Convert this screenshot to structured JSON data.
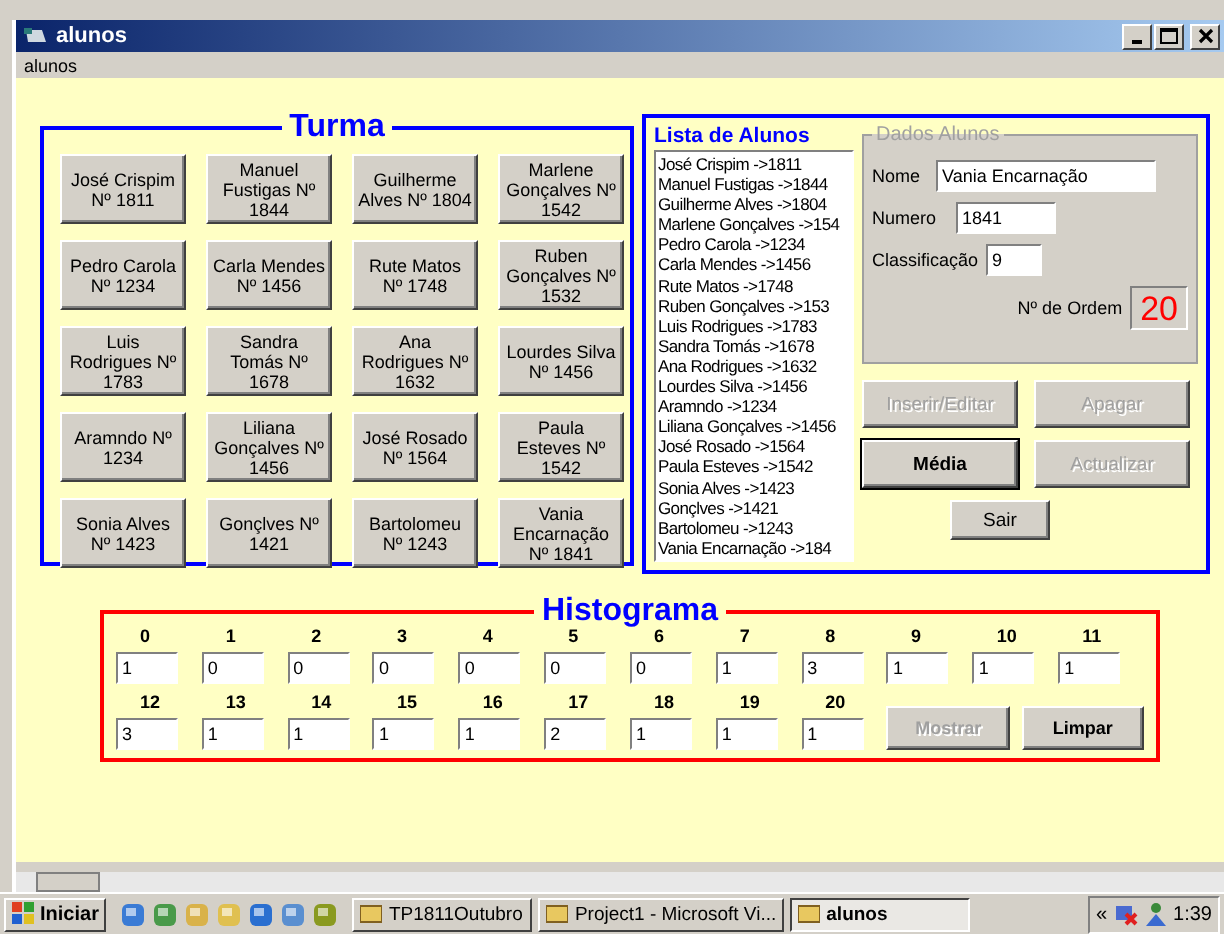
{
  "window": {
    "title": "alunos",
    "menu": [
      "alunos"
    ]
  },
  "turma": {
    "title": "Turma",
    "students": [
      "José Crispim Nº 1811",
      "Manuel Fustigas Nº 1844",
      "Guilherme Alves Nº 1804",
      "Marlene Gonçalves Nº 1542",
      "Pedro Carola Nº 1234",
      "Carla Mendes Nº 1456",
      "Rute Matos Nº 1748",
      "Ruben Gonçalves Nº 1532",
      "Luis Rodrigues Nº 1783",
      "Sandra Tomás Nº 1678",
      "Ana Rodrigues Nº 1632",
      "Lourdes Silva Nº 1456",
      "Aramndo Nº 1234",
      "Liliana Gonçalves Nº 1456",
      "José Rosado Nº 1564",
      "Paula Esteves Nº 1542",
      "Sonia Alves Nº 1423",
      "Gonçlves Nº 1421",
      "Bartolomeu Nº 1243",
      "Vania Encarnação Nº 1841"
    ]
  },
  "lista": {
    "title": "Lista de Alunos",
    "items": [
      "José Crispim ->1811",
      "Manuel Fustigas ->1844",
      "Guilherme Alves ->1804",
      "Marlene Gonçalves ->154",
      "Pedro Carola ->1234",
      "Carla Mendes ->1456",
      "Rute Matos ->1748",
      "Ruben Gonçalves ->153",
      "Luis Rodrigues ->1783",
      "Sandra Tomás ->1678",
      "Ana Rodrigues ->1632",
      "Lourdes Silva ->1456",
      "Aramndo ->1234",
      "Liliana Gonçalves ->1456",
      "José Rosado ->1564",
      "Paula Esteves ->1542",
      "Sonia Alves ->1423",
      "Gonçlves ->1421",
      "Bartolomeu ->1243",
      "Vania Encarnação ->184"
    ]
  },
  "dados": {
    "title": "Dados Alunos",
    "nome_label": "Nome",
    "nome": "Vania Encarnação",
    "numero_label": "Numero",
    "numero": "1841",
    "classificacao_label": "Classificação",
    "classificacao": "9",
    "ordem_label": "Nº de Ordem",
    "ordem": "20"
  },
  "buttons": [
    {
      "label": "Inserir/Editar",
      "disabled": true,
      "default": false
    },
    {
      "label": "Apagar",
      "disabled": true,
      "default": false
    },
    {
      "label": "Média",
      "disabled": false,
      "default": true
    },
    {
      "label": "Actualizar",
      "disabled": true,
      "default": false
    }
  ],
  "sair": {
    "label": "Sair"
  },
  "histograma": {
    "title": "Histograma",
    "bins": [
      {
        "label": "0",
        "value": "1"
      },
      {
        "label": "1",
        "value": "0"
      },
      {
        "label": "2",
        "value": "0"
      },
      {
        "label": "3",
        "value": "0"
      },
      {
        "label": "4",
        "value": "0"
      },
      {
        "label": "5",
        "value": "0"
      },
      {
        "label": "6",
        "value": "0"
      },
      {
        "label": "7",
        "value": "1"
      },
      {
        "label": "8",
        "value": "3"
      },
      {
        "label": "9",
        "value": "1"
      },
      {
        "label": "10",
        "value": "1"
      },
      {
        "label": "11",
        "value": "1"
      },
      {
        "label": "12",
        "value": "3"
      },
      {
        "label": "13",
        "value": "1"
      },
      {
        "label": "14",
        "value": "1"
      },
      {
        "label": "15",
        "value": "1"
      },
      {
        "label": "16",
        "value": "1"
      },
      {
        "label": "17",
        "value": "2"
      },
      {
        "label": "18",
        "value": "1"
      },
      {
        "label": "19",
        "value": "1"
      },
      {
        "label": "20",
        "value": "1"
      }
    ],
    "buttons": [
      {
        "label": "Mostrar",
        "disabled": true
      },
      {
        "label": "Limpar",
        "disabled": false
      }
    ]
  },
  "taskbar": {
    "start": "Iniciar",
    "tasks": [
      {
        "label": "TP1811Outubro",
        "selected": false
      },
      {
        "label": "Project1 - Microsoft Vi...",
        "selected": false
      },
      {
        "label": "alunos",
        "selected": true
      }
    ],
    "tray_expand": "«",
    "clock": "1:39"
  }
}
